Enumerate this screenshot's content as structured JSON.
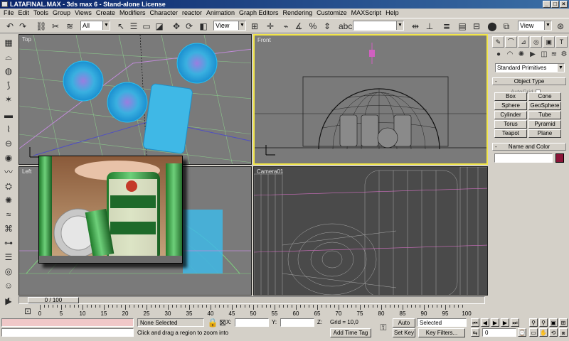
{
  "window": {
    "title": "LATAFINAL.MAX - 3ds max 6 - Stand-alone License"
  },
  "menu": [
    "File",
    "Edit",
    "Tools",
    "Group",
    "Views",
    "Create",
    "Modifiers",
    "Character",
    "reactor",
    "Animation",
    "Graph Editors",
    "Rendering",
    "Customize",
    "MAXScript",
    "Help"
  ],
  "toolbar": {
    "selection_filter": "All",
    "ref_coord": "View",
    "named_selection": "",
    "render_view": "View"
  },
  "viewports": {
    "top": "Top",
    "front": "Front",
    "left": "Left",
    "perspective": "Camera01"
  },
  "command_panel": {
    "category": "Standard Primitives",
    "object_type_header": "Object Type",
    "autogrid": "AutoGrid",
    "primitives": [
      "Box",
      "Cone",
      "Sphere",
      "GeoSphere",
      "Cylinder",
      "Tube",
      "Torus",
      "Pyramid",
      "Teapot",
      "Plane"
    ],
    "name_color_header": "Name and Color",
    "object_color": "#8a1538"
  },
  "timeline": {
    "frame_display": "0 / 100",
    "ticks": [
      "0",
      "5",
      "10",
      "15",
      "20",
      "25",
      "30",
      "35",
      "40",
      "45",
      "50",
      "55",
      "60",
      "65",
      "70",
      "75",
      "80",
      "85",
      "90",
      "95",
      "100"
    ]
  },
  "status": {
    "selection": "None Selected",
    "prompt": "Click and drag a region to zoom into",
    "x_label": "X:",
    "y_label": "Y:",
    "z_label": "Z:",
    "grid": "Grid = 10,0",
    "add_time_tag": "Add Time Tag",
    "auto_key": "Auto Key",
    "set_key": "Set Key",
    "key_mode": "Selected",
    "key_filters": "Key Filters...",
    "current_frame": "0"
  }
}
